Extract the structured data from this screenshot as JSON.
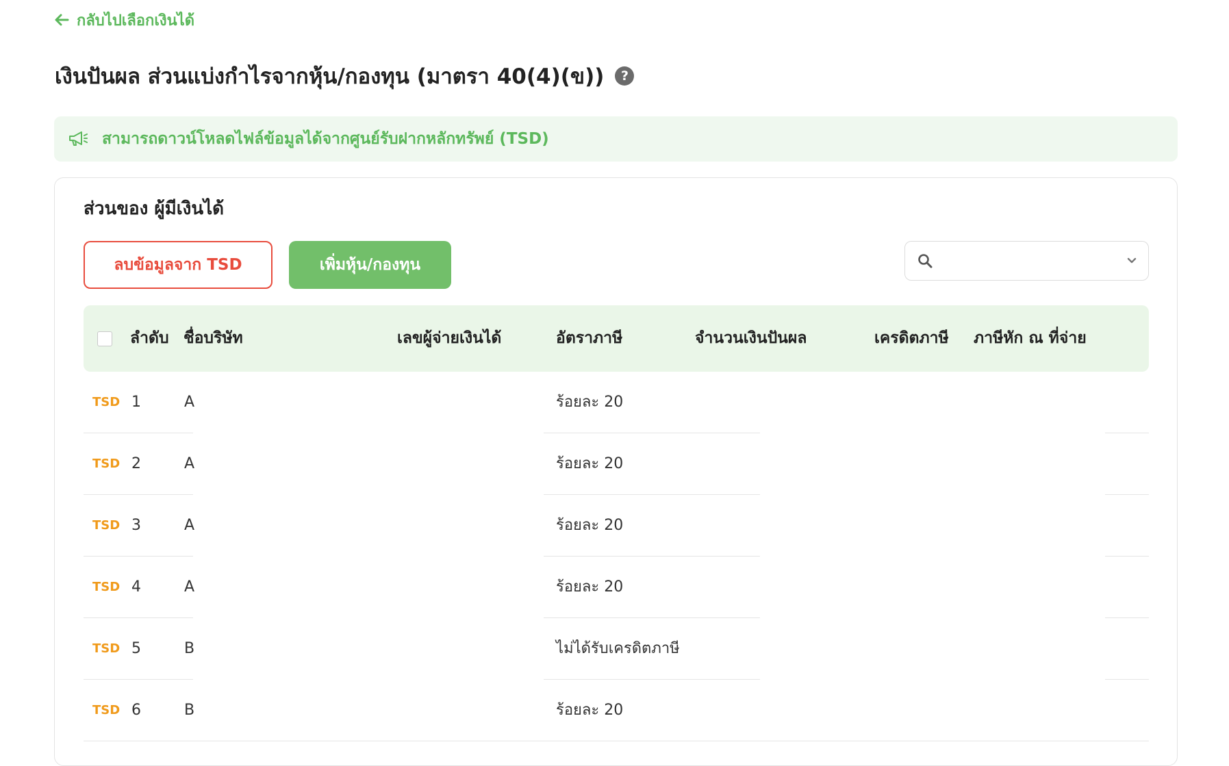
{
  "back_link": {
    "label": "กลับไปเลือกเงินได้"
  },
  "page": {
    "title": "เงินปันผล ส่วนแบ่งกำไรจากหุ้น/กองทุน (มาตรา 40(4)(ข))",
    "help_symbol": "?"
  },
  "notice": {
    "text": "สามารถดาวน์โหลดไฟล์ข้อมูลได้จากศูนย์รับฝากหลักทรัพย์ (TSD)"
  },
  "section": {
    "title": "ส่วนของ ผู้มีเงินได้"
  },
  "actions": {
    "remove_tsd": "ลบข้อมูลจาก TSD",
    "add_stock": "เพิ่มหุ้น/กองทุน"
  },
  "search": {
    "placeholder": "",
    "value": ""
  },
  "table": {
    "columns": {
      "no": "ลำดับ",
      "company": "ชื่อบริษัท",
      "payer_id": "เลขผู้จ่ายเงินได้",
      "tax_rate": "อัตราภาษี",
      "dividend": "จำนวนเงินปันผล",
      "tax_credit": "เครดิตภาษี",
      "withholding": "ภาษีหัก ณ ที่จ่าย"
    },
    "rows": [
      {
        "badge": "TSD",
        "no": "1",
        "company": "A",
        "tax_rate": "ร้อยละ 20"
      },
      {
        "badge": "TSD",
        "no": "2",
        "company": "A",
        "tax_rate": "ร้อยละ 20"
      },
      {
        "badge": "TSD",
        "no": "3",
        "company": "A",
        "tax_rate": "ร้อยละ 20"
      },
      {
        "badge": "TSD",
        "no": "4",
        "company": "A",
        "tax_rate": "ร้อยละ 20"
      },
      {
        "badge": "TSD",
        "no": "5",
        "company": "B",
        "tax_rate": "ไม่ได้รับเครดิตภาษี"
      },
      {
        "badge": "TSD",
        "no": "6",
        "company": "B",
        "tax_rate": "ร้อยละ 20"
      }
    ]
  },
  "colors": {
    "green": "#5cb85c",
    "red": "#e84c3d",
    "orange": "#f09a1a",
    "header_bg": "#eaf6e8"
  }
}
